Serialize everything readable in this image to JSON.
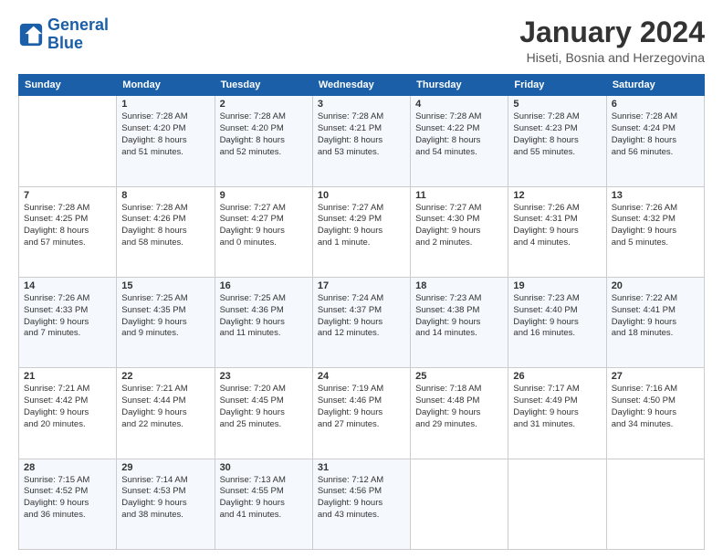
{
  "logo": {
    "line1": "General",
    "line2": "Blue"
  },
  "header": {
    "title": "January 2024",
    "subtitle": "Hiseti, Bosnia and Herzegovina"
  },
  "weekdays": [
    "Sunday",
    "Monday",
    "Tuesday",
    "Wednesday",
    "Thursday",
    "Friday",
    "Saturday"
  ],
  "weeks": [
    [
      {
        "day": "",
        "info": ""
      },
      {
        "day": "1",
        "info": "Sunrise: 7:28 AM\nSunset: 4:20 PM\nDaylight: 8 hours\nand 51 minutes."
      },
      {
        "day": "2",
        "info": "Sunrise: 7:28 AM\nSunset: 4:20 PM\nDaylight: 8 hours\nand 52 minutes."
      },
      {
        "day": "3",
        "info": "Sunrise: 7:28 AM\nSunset: 4:21 PM\nDaylight: 8 hours\nand 53 minutes."
      },
      {
        "day": "4",
        "info": "Sunrise: 7:28 AM\nSunset: 4:22 PM\nDaylight: 8 hours\nand 54 minutes."
      },
      {
        "day": "5",
        "info": "Sunrise: 7:28 AM\nSunset: 4:23 PM\nDaylight: 8 hours\nand 55 minutes."
      },
      {
        "day": "6",
        "info": "Sunrise: 7:28 AM\nSunset: 4:24 PM\nDaylight: 8 hours\nand 56 minutes."
      }
    ],
    [
      {
        "day": "7",
        "info": "Sunrise: 7:28 AM\nSunset: 4:25 PM\nDaylight: 8 hours\nand 57 minutes."
      },
      {
        "day": "8",
        "info": "Sunrise: 7:28 AM\nSunset: 4:26 PM\nDaylight: 8 hours\nand 58 minutes."
      },
      {
        "day": "9",
        "info": "Sunrise: 7:27 AM\nSunset: 4:27 PM\nDaylight: 9 hours\nand 0 minutes."
      },
      {
        "day": "10",
        "info": "Sunrise: 7:27 AM\nSunset: 4:29 PM\nDaylight: 9 hours\nand 1 minute."
      },
      {
        "day": "11",
        "info": "Sunrise: 7:27 AM\nSunset: 4:30 PM\nDaylight: 9 hours\nand 2 minutes."
      },
      {
        "day": "12",
        "info": "Sunrise: 7:26 AM\nSunset: 4:31 PM\nDaylight: 9 hours\nand 4 minutes."
      },
      {
        "day": "13",
        "info": "Sunrise: 7:26 AM\nSunset: 4:32 PM\nDaylight: 9 hours\nand 5 minutes."
      }
    ],
    [
      {
        "day": "14",
        "info": "Sunrise: 7:26 AM\nSunset: 4:33 PM\nDaylight: 9 hours\nand 7 minutes."
      },
      {
        "day": "15",
        "info": "Sunrise: 7:25 AM\nSunset: 4:35 PM\nDaylight: 9 hours\nand 9 minutes."
      },
      {
        "day": "16",
        "info": "Sunrise: 7:25 AM\nSunset: 4:36 PM\nDaylight: 9 hours\nand 11 minutes."
      },
      {
        "day": "17",
        "info": "Sunrise: 7:24 AM\nSunset: 4:37 PM\nDaylight: 9 hours\nand 12 minutes."
      },
      {
        "day": "18",
        "info": "Sunrise: 7:23 AM\nSunset: 4:38 PM\nDaylight: 9 hours\nand 14 minutes."
      },
      {
        "day": "19",
        "info": "Sunrise: 7:23 AM\nSunset: 4:40 PM\nDaylight: 9 hours\nand 16 minutes."
      },
      {
        "day": "20",
        "info": "Sunrise: 7:22 AM\nSunset: 4:41 PM\nDaylight: 9 hours\nand 18 minutes."
      }
    ],
    [
      {
        "day": "21",
        "info": "Sunrise: 7:21 AM\nSunset: 4:42 PM\nDaylight: 9 hours\nand 20 minutes."
      },
      {
        "day": "22",
        "info": "Sunrise: 7:21 AM\nSunset: 4:44 PM\nDaylight: 9 hours\nand 22 minutes."
      },
      {
        "day": "23",
        "info": "Sunrise: 7:20 AM\nSunset: 4:45 PM\nDaylight: 9 hours\nand 25 minutes."
      },
      {
        "day": "24",
        "info": "Sunrise: 7:19 AM\nSunset: 4:46 PM\nDaylight: 9 hours\nand 27 minutes."
      },
      {
        "day": "25",
        "info": "Sunrise: 7:18 AM\nSunset: 4:48 PM\nDaylight: 9 hours\nand 29 minutes."
      },
      {
        "day": "26",
        "info": "Sunrise: 7:17 AM\nSunset: 4:49 PM\nDaylight: 9 hours\nand 31 minutes."
      },
      {
        "day": "27",
        "info": "Sunrise: 7:16 AM\nSunset: 4:50 PM\nDaylight: 9 hours\nand 34 minutes."
      }
    ],
    [
      {
        "day": "28",
        "info": "Sunrise: 7:15 AM\nSunset: 4:52 PM\nDaylight: 9 hours\nand 36 minutes."
      },
      {
        "day": "29",
        "info": "Sunrise: 7:14 AM\nSunset: 4:53 PM\nDaylight: 9 hours\nand 38 minutes."
      },
      {
        "day": "30",
        "info": "Sunrise: 7:13 AM\nSunset: 4:55 PM\nDaylight: 9 hours\nand 41 minutes."
      },
      {
        "day": "31",
        "info": "Sunrise: 7:12 AM\nSunset: 4:56 PM\nDaylight: 9 hours\nand 43 minutes."
      },
      {
        "day": "",
        "info": ""
      },
      {
        "day": "",
        "info": ""
      },
      {
        "day": "",
        "info": ""
      }
    ]
  ]
}
